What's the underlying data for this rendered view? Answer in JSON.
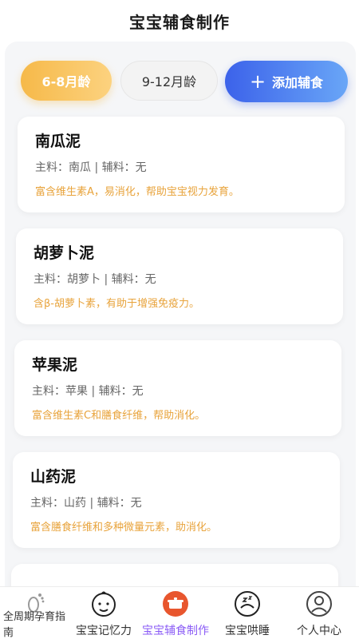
{
  "header": {
    "title": "宝宝辅食制作"
  },
  "tabs": {
    "active": "6-8月龄",
    "inactive": "9-12月龄",
    "add_label": "添加辅食"
  },
  "recipes": [
    {
      "name": "南瓜泥",
      "ingredients": "主料：南瓜 | 辅料：无",
      "desc": "富含维生素A，易消化，帮助宝宝视力发育。"
    },
    {
      "name": "胡萝卜泥",
      "ingredients": "主料：胡萝卜 | 辅料：无",
      "desc": "含β-胡萝卜素，有助于增强免疫力。"
    },
    {
      "name": "苹果泥",
      "ingredients": "主料：苹果 | 辅料：无",
      "desc": "富含维生素C和膳食纤维，帮助消化。"
    },
    {
      "name": "山药泥",
      "ingredients": "主料：山药 | 辅料：无",
      "desc": "富含膳食纤维和多种微量元素，助消化。"
    }
  ],
  "tabbar": {
    "items": [
      {
        "label": "全周期孕育指南",
        "icon": "footprint-icon"
      },
      {
        "label": "宝宝记忆力",
        "icon": "baby-face-icon"
      },
      {
        "label": "宝宝辅食制作",
        "icon": "cooking-pot-icon"
      },
      {
        "label": "宝宝哄睡",
        "icon": "sleeping-baby-icon"
      },
      {
        "label": "个人中心",
        "icon": "user-icon"
      }
    ],
    "active_color": "#8b5cf6"
  },
  "colors": {
    "accent_orange": "#f6b949",
    "accent_blue": "#3c62ea",
    "desc_text": "#e8a33b"
  }
}
